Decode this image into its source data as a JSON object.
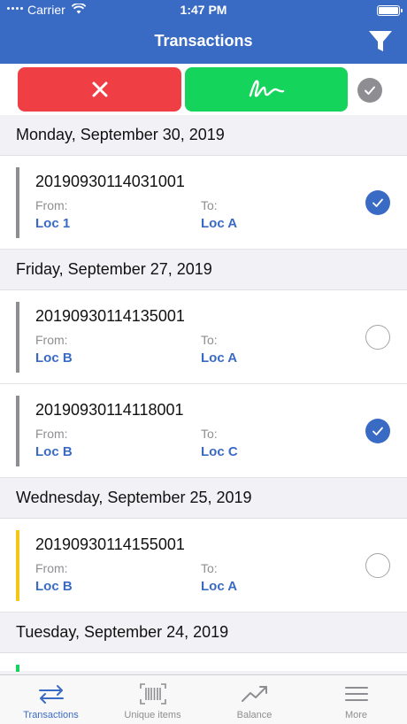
{
  "status_bar": {
    "carrier": "Carrier",
    "time": "1:47 PM"
  },
  "header": {
    "title": "Transactions",
    "filter_icon": "filter-funnel-icon"
  },
  "action_bar": {
    "reject_icon": "close-x-icon",
    "sign_icon": "signature-icon",
    "select_all_icon": "check-icon"
  },
  "sections": [
    {
      "date": "Monday, September 30, 2019",
      "rows": [
        {
          "id": "20190930114031001",
          "from_label": "From:",
          "from": "Loc 1",
          "to_label": "To:",
          "to": "Loc A",
          "selected": true,
          "stripe_color": "#8e8e92"
        }
      ]
    },
    {
      "date": "Friday, September 27, 2019",
      "rows": [
        {
          "id": "20190930114135001",
          "from_label": "From:",
          "from": "Loc B",
          "to_label": "To:",
          "to": "Loc A",
          "selected": false,
          "stripe_color": "#8e8e92"
        },
        {
          "id": "20190930114118001",
          "from_label": "From:",
          "from": "Loc B",
          "to_label": "To:",
          "to": "Loc C",
          "selected": true,
          "stripe_color": "#8e8e92"
        }
      ]
    },
    {
      "date": "Wednesday, September 25, 2019",
      "rows": [
        {
          "id": "20190930114155001",
          "from_label": "From:",
          "from": "Loc B",
          "to_label": "To:",
          "to": "Loc A",
          "selected": false,
          "stripe_color": "#f5c518"
        }
      ]
    },
    {
      "date": "Tuesday, September 24, 2019",
      "rows": []
    }
  ],
  "tabs": [
    {
      "label": "Transactions",
      "icon": "transfer-arrows-icon",
      "active": true
    },
    {
      "label": "Unique items",
      "icon": "barcode-icon",
      "active": false
    },
    {
      "label": "Balance",
      "icon": "trend-chart-icon",
      "active": false
    },
    {
      "label": "More",
      "icon": "menu-lines-icon",
      "active": false
    }
  ],
  "colors": {
    "accent": "#3a6bc4",
    "reject": "#ef3e44",
    "sign": "#15d45c",
    "stripe_pending": "#f5c518",
    "stripe_partial": "#15d45c"
  }
}
